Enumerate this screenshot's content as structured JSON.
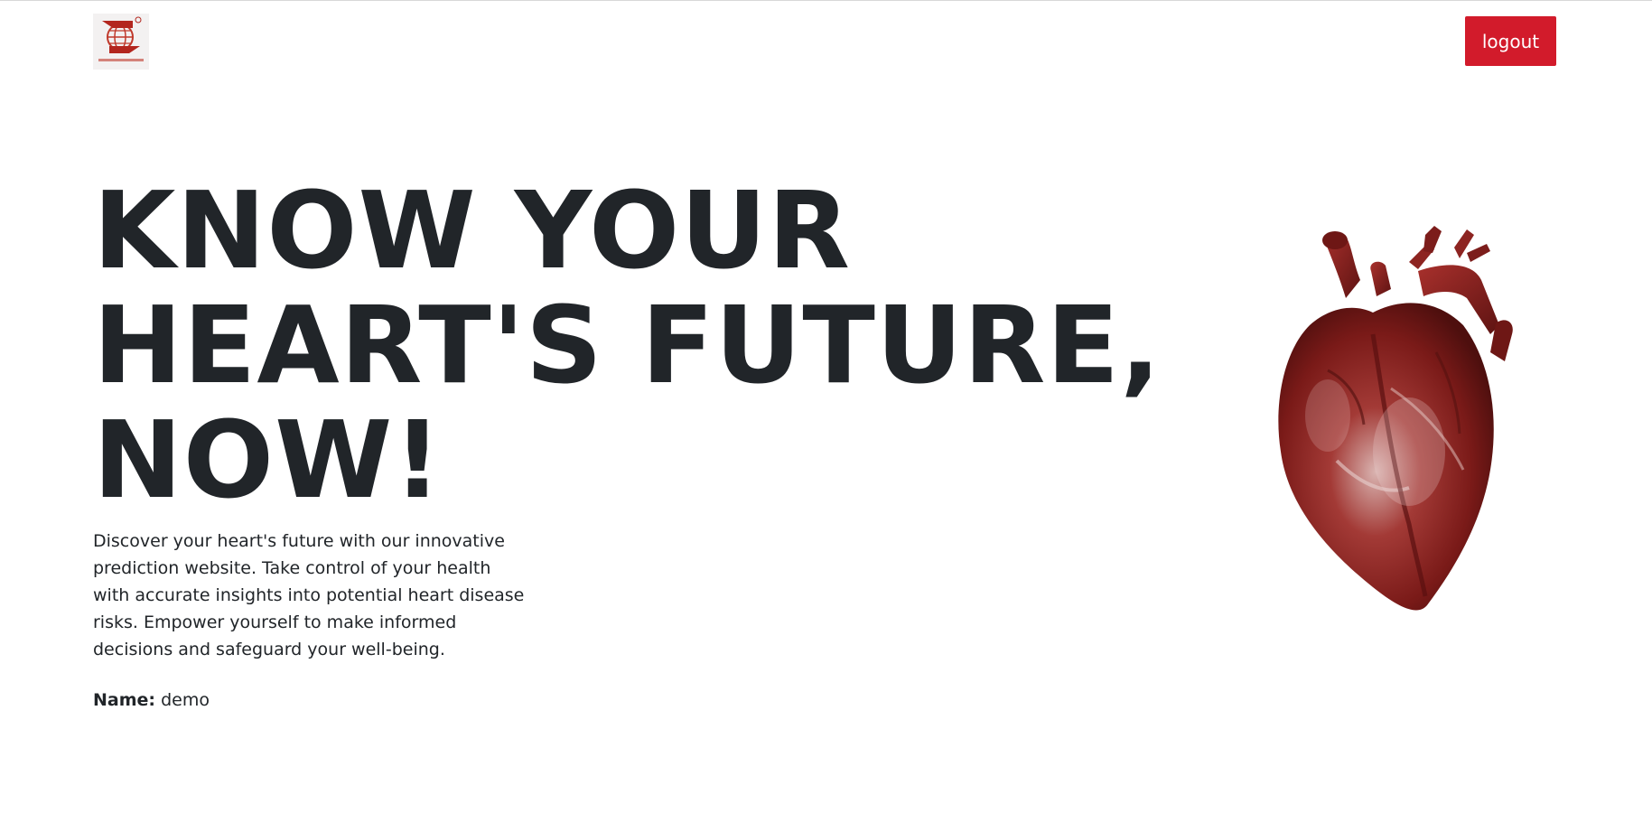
{
  "header": {
    "logo_alt": "logo",
    "logout_label": "logout"
  },
  "hero": {
    "title_lines": [
      "KNOW YOUR",
      "HEART'S FUTURE,",
      "NOW!"
    ],
    "description": "Discover your heart's future with our innovative prediction website. Take control of your health with accurate insights into potential heart disease risks. Empower yourself to make informed decisions and safeguard your well-being.",
    "name_label": "Name:",
    "name_value": "demo"
  },
  "colors": {
    "accent": "#d21b2b",
    "text": "#212529",
    "heart": "#8e1c1c"
  },
  "icons": {
    "logo": "company-logo-icon",
    "heart": "anatomical-heart-image"
  }
}
